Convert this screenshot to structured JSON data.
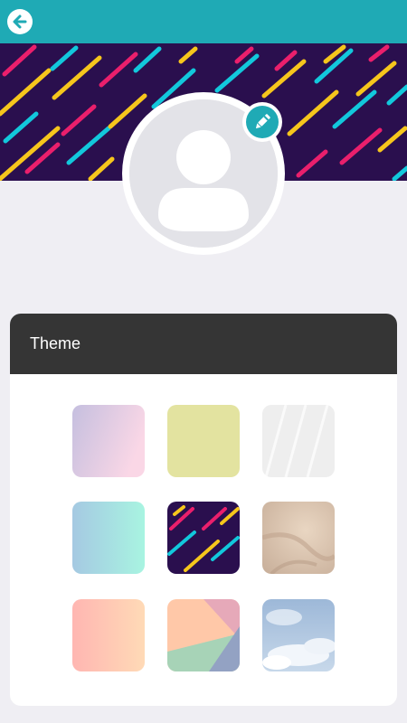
{
  "app": {
    "accent_color": "#1faab5",
    "back_icon": "arrow-left-icon",
    "edit_icon": "pencil-icon",
    "avatar_icon": "user-placeholder-icon"
  },
  "theme_panel": {
    "title": "Theme",
    "header_color": "#353535",
    "swatches": [
      {
        "name": "lavender-pink-gradient",
        "colors": [
          "#c5bfdf",
          "#fad7e6"
        ]
      },
      {
        "name": "yellow-green-solid",
        "colors": [
          "#e4e4a0",
          "#e2e29c"
        ]
      },
      {
        "name": "white-diagonal-streaks",
        "colors": [
          "#f2f2f2",
          "#e8e8e8"
        ]
      },
      {
        "name": "blue-mint-gradient",
        "colors": [
          "#a5cde1",
          "#a6f2e0"
        ]
      },
      {
        "name": "neon-streaks-on-purple",
        "colors": [
          "#2a0f4e",
          "#f6c61c"
        ]
      },
      {
        "name": "sand-texture",
        "colors": [
          "#e8d3be",
          "#c9b09a"
        ]
      },
      {
        "name": "peach-gradient",
        "colors": [
          "#ffb7b3",
          "#ffd8b5"
        ]
      },
      {
        "name": "pastel-geometric",
        "colors": [
          "#ffc4a5",
          "#9aa4c2"
        ]
      },
      {
        "name": "sky-clouds",
        "colors": [
          "#a7c1df",
          "#e9eff7"
        ]
      }
    ]
  }
}
